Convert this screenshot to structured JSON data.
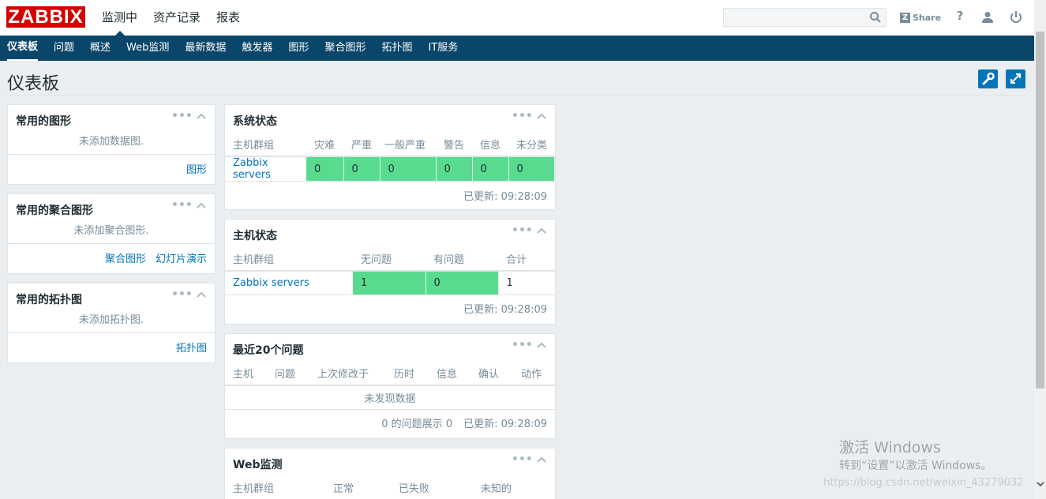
{
  "logo": "ZABBIX",
  "topnav": [
    "监测中",
    "资产记录",
    "报表"
  ],
  "search": {
    "placeholder": "",
    "value": ""
  },
  "share_label": "Share",
  "help_label": "?",
  "subnav": [
    "仪表板",
    "问题",
    "概述",
    "Web监测",
    "最新数据",
    "触发器",
    "图形",
    "聚合图形",
    "拓扑图",
    "IT服务"
  ],
  "page_title": "仪表板",
  "left_widgets": {
    "graphs": {
      "title": "常用的图形",
      "empty": "未添加数据图.",
      "links": [
        "图形"
      ]
    },
    "screens": {
      "title": "常用的聚合图形",
      "empty": "未添加聚合图形.",
      "links": [
        "聚合图形",
        "幻灯片演示"
      ]
    },
    "maps": {
      "title": "常用的拓扑图",
      "empty": "未添加拓扑图.",
      "links": [
        "拓扑图"
      ]
    }
  },
  "system_status": {
    "title": "系统状态",
    "columns": [
      "主机群组",
      "灾难",
      "严重",
      "一般严重",
      "警告",
      "信息",
      "未分类"
    ],
    "row": {
      "group": "Zabbix servers",
      "values": [
        "0",
        "0",
        "0",
        "0",
        "0",
        "0"
      ]
    },
    "updated": "已更新: 09:28:09"
  },
  "host_status": {
    "title": "主机状态",
    "columns": [
      "主机群组",
      "无问题",
      "有问题",
      "合计"
    ],
    "row": {
      "group": "Zabbix servers",
      "values": [
        "1",
        "0",
        "1"
      ]
    },
    "updated": "已更新: 09:28:09"
  },
  "last_issues": {
    "title": "最近20个问题",
    "columns": [
      "主机",
      "问题",
      "上次修改于",
      "历时",
      "信息",
      "确认",
      "动作"
    ],
    "empty": "未发现数据",
    "count": "0 的问题展示 0",
    "updated": "已更新: 09:28:09"
  },
  "web_monitoring": {
    "title": "Web监测",
    "columns": [
      "主机群组",
      "正常",
      "已失败",
      "未知的"
    ]
  },
  "dots": "•••",
  "watermark": {
    "line1": "激活 Windows",
    "line2": "转到“设置”以激活 Windows。",
    "url": "https://blog.csdn.net/weixin_43279032"
  },
  "colors": {
    "nav": "#0a466a",
    "logo": "#d40000",
    "ok": "#59db8f",
    "link": "#0275b8"
  }
}
